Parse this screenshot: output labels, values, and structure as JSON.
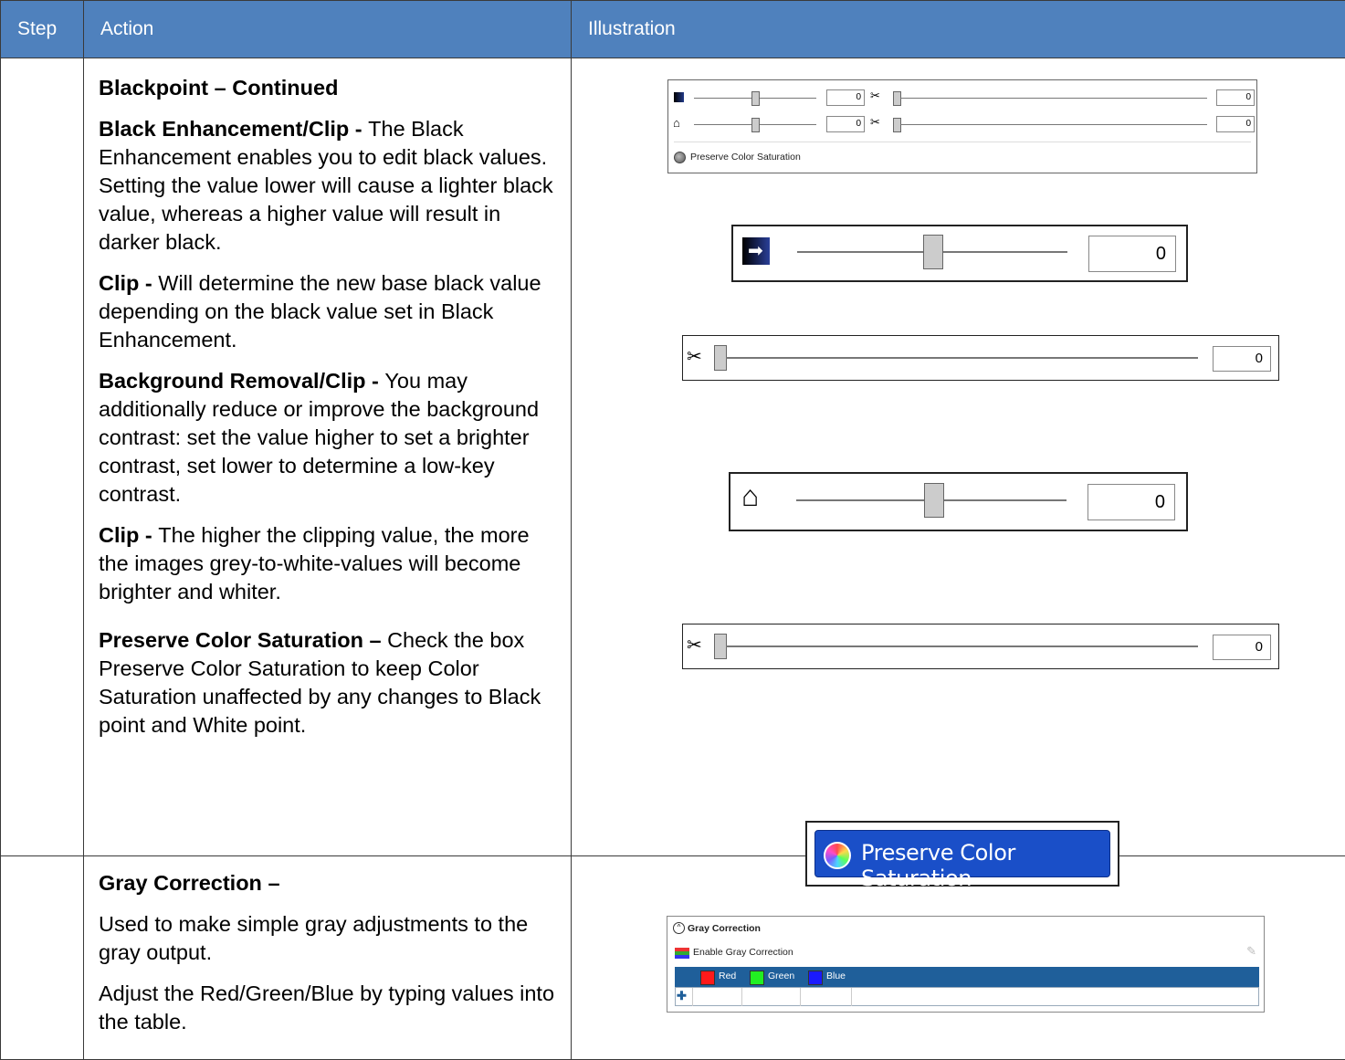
{
  "header": {
    "step": "Step",
    "action": "Action",
    "illustration": "Illustration"
  },
  "row1": {
    "heading": "Blackpoint – Continued",
    "p1_bold": "Black Enhancement/Clip - ",
    "p1_text": "The Black Enhancement enables you to edit black values. Setting the value lower will cause a lighter black value, whereas a higher value will result in darker black.",
    "p2_bold": "Clip - ",
    "p2_text": "Will determine the new base black value depending on the black value set in Black Enhancement.",
    "p3_bold": "Background Removal/Clip - ",
    "p3_text": "You may additionally reduce or improve the background contrast: set the value higher to set a brighter contrast, set lower to determine a low-key contrast.",
    "p4_bold": "Clip - ",
    "p4_text": "The higher the clipping value, the more the images grey-to-white-values will become brighter and whiter.",
    "p5_bold": "Preserve Color Saturation – ",
    "p5_text": "Check the box Preserve Color Saturation to keep Color Saturation unaffected by any changes to Black point and White point.",
    "panel": {
      "black_value": "0",
      "black_clip_value": "0",
      "bg_value": "0",
      "bg_clip_value": "0",
      "preserve_label": "Preserve Color Saturation"
    },
    "zoom": {
      "black_value": "0",
      "black_clip_value": "0",
      "bg_value": "0",
      "bg_clip_value": "0",
      "preserve_label": "Preserve Color Saturation"
    }
  },
  "row2": {
    "heading": "Gray Correction –",
    "p1": "Used to make simple gray adjustments to the gray output.",
    "p2": "Adjust the Red/Green/Blue by typing values into the table.",
    "panel": {
      "title": "Gray Correction",
      "enable_label": "Enable Gray Correction",
      "columns": [
        "Red",
        "Green",
        "Blue"
      ],
      "colors": [
        "#ff1a1a",
        "#22ee22",
        "#1a1aff"
      ]
    }
  }
}
